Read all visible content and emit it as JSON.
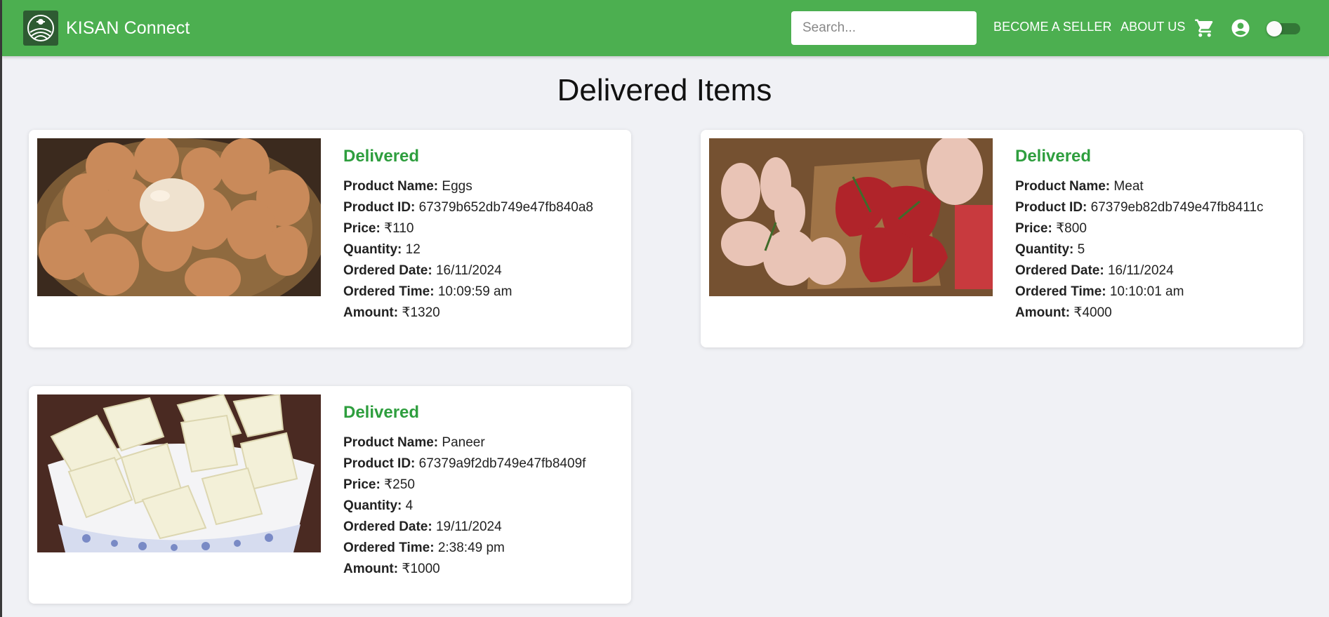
{
  "app": {
    "brand": "KISAN Connect",
    "logo_icon": "farm-logo-icon"
  },
  "nav": {
    "search_placeholder": "Search...",
    "become_seller": "BECOME A SELLER",
    "about_us": "ABOUT US",
    "cart_icon": "cart-icon",
    "account_icon": "account-icon",
    "theme_toggle": "off"
  },
  "page": {
    "title": "Delivered Items"
  },
  "labels": {
    "product_name": "Product Name:",
    "product_id": "Product ID:",
    "price": "Price:",
    "quantity": "Quantity:",
    "ordered_date": "Ordered Date:",
    "ordered_time": "Ordered Time:",
    "amount": "Amount:"
  },
  "colors": {
    "brand": "#4caf50",
    "status": "#2e9e3e",
    "background": "#f0f1f5"
  },
  "items": [
    {
      "status": "Delivered",
      "image": "eggs-in-basket",
      "product_name": "Eggs",
      "product_id": "67379b652db749e47fb840a8",
      "price": "₹110",
      "quantity": "12",
      "ordered_date": "16/11/2024",
      "ordered_time": "10:09:59 am",
      "amount": "₹1320"
    },
    {
      "status": "Delivered",
      "image": "raw-meat-on-board",
      "product_name": "Meat",
      "product_id": "67379eb82db749e47fb8411c",
      "price": "₹800",
      "quantity": "5",
      "ordered_date": "16/11/2024",
      "ordered_time": "10:10:01 am",
      "amount": "₹4000"
    },
    {
      "status": "Delivered",
      "image": "paneer-cubes-in-bowl",
      "product_name": "Paneer",
      "product_id": "67379a9f2db749e47fb8409f",
      "price": "₹250",
      "quantity": "4",
      "ordered_date": "19/11/2024",
      "ordered_time": "2:38:49 pm",
      "amount": "₹1000"
    }
  ]
}
